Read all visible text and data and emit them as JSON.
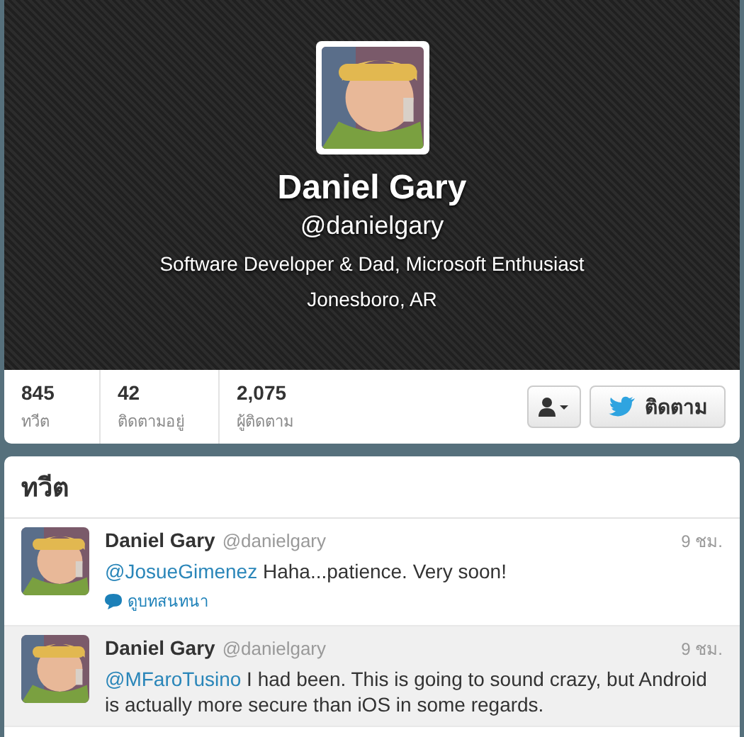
{
  "profile": {
    "name": "Daniel Gary",
    "handle": "@danielgary",
    "bio": "Software Developer & Dad, Microsoft Enthusiast",
    "location": "Jonesboro, AR"
  },
  "stats": [
    {
      "value": "845",
      "label": "ทวีต"
    },
    {
      "value": "42",
      "label": "ติดตามอยู่"
    },
    {
      "value": "2,075",
      "label": "ผู้ติดตาม"
    }
  ],
  "follow_button": {
    "label": "ติดตาม"
  },
  "tweets_heading": "ทวีต",
  "tweets": [
    {
      "name": "Daniel Gary",
      "handle": "@danielgary",
      "time": "9 ชม.",
      "mention": "@JosueGimenez",
      "text": " Haha...patience.  Very soon!",
      "conversation_link": "ดูบทสนทนา",
      "highlighted": false
    },
    {
      "name": "Daniel Gary",
      "handle": "@danielgary",
      "time": "9 ชม.",
      "mention": "@MFaroTusino",
      "text": " I had been.  This is going to sound crazy, but Android is actually more secure than iOS in some regards.",
      "highlighted": true
    }
  ]
}
